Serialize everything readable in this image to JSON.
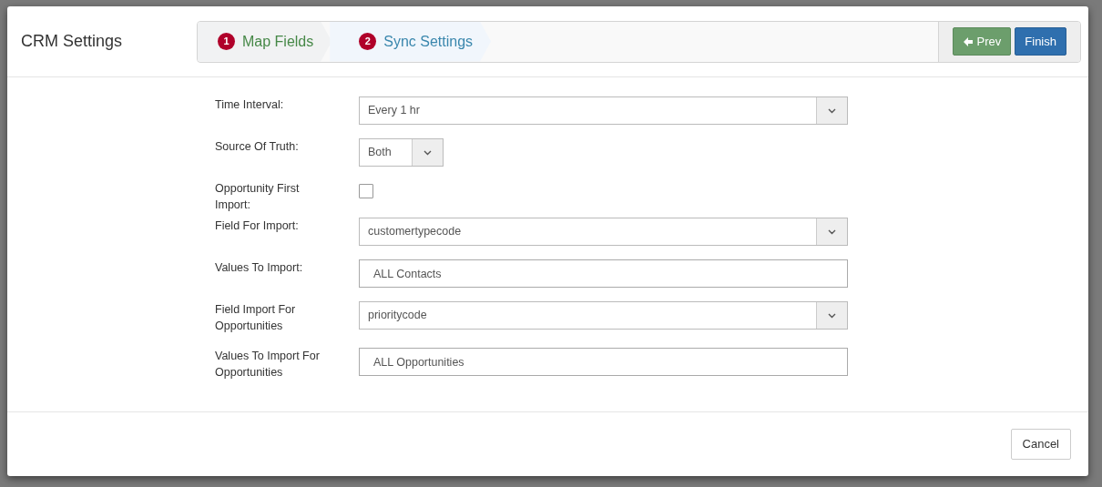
{
  "modal": {
    "title": "CRM Settings",
    "steps": [
      {
        "number": "1",
        "label": "Map Fields",
        "selected": false
      },
      {
        "number": "2",
        "label": "Sync Settings",
        "selected": true
      }
    ],
    "prev_button": "Prev",
    "finish_button": "Finish",
    "fields": [
      {
        "kind": "select",
        "label": "Time Interval:",
        "value": "Every 1 hr"
      },
      {
        "kind": "select-small",
        "label": "Source Of Truth:",
        "value": "Both"
      },
      {
        "kind": "checkbox",
        "label": "Opportunity First Import:",
        "checked": false
      },
      {
        "kind": "select",
        "label": "Field For Import:",
        "value": "customertypecode"
      },
      {
        "kind": "text",
        "label": "Values To Import:",
        "value": "ALL Contacts"
      },
      {
        "kind": "select",
        "label": "Field Import For Opportunities",
        "value": "prioritycode"
      },
      {
        "kind": "text",
        "label": "Values To Import For Opportunities",
        "value": "ALL Opportunities"
      }
    ],
    "cancel_button": "Cancel"
  }
}
